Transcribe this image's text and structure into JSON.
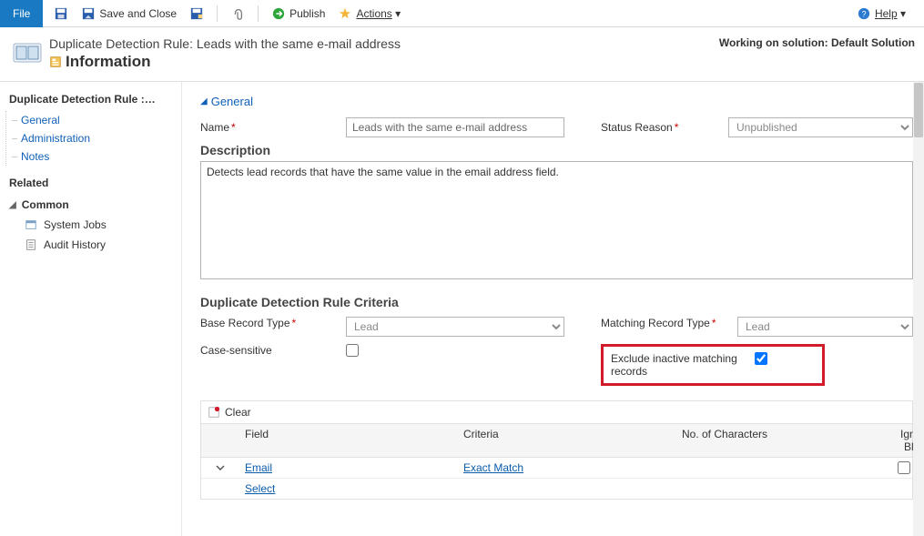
{
  "toolbar": {
    "file": "File",
    "save_and_close": "Save and Close",
    "publish": "Publish",
    "actions": "Actions",
    "help": "Help"
  },
  "header": {
    "title": "Duplicate Detection Rule: Leads with the same e-mail address",
    "subtitle": "Information",
    "solution": "Working on solution: Default Solution"
  },
  "sidebar": {
    "title": "Duplicate Detection Rule :…",
    "tree": [
      {
        "label": "General"
      },
      {
        "label": "Administration"
      },
      {
        "label": "Notes"
      }
    ],
    "related": "Related",
    "common": "Common",
    "common_items": [
      {
        "label": "System Jobs"
      },
      {
        "label": "Audit History"
      }
    ]
  },
  "general": {
    "section": "General",
    "name_label": "Name",
    "name_value": "Leads with the same e-mail address",
    "status_label": "Status Reason",
    "status_value": "Unpublished",
    "desc_label": "Description",
    "desc_value": "Detects lead records that have the same value in the email address field."
  },
  "criteria": {
    "title": "Duplicate Detection Rule Criteria",
    "base_label": "Base Record Type",
    "base_value": "Lead",
    "matching_label": "Matching Record Type",
    "matching_value": "Lead",
    "case_label": "Case-sensitive",
    "exclude_label": "Exclude inactive matching records",
    "clear": "Clear",
    "head_field": "Field",
    "head_criteria": "Criteria",
    "head_nochars": "No. of Characters",
    "head_ignore": "Ignore Blank",
    "rows": [
      {
        "field": "Email",
        "criteria": "Exact Match",
        "nochars": "",
        "ignore": false
      },
      {
        "field": "Select",
        "criteria": "",
        "nochars": "",
        "ignore": null
      }
    ]
  }
}
